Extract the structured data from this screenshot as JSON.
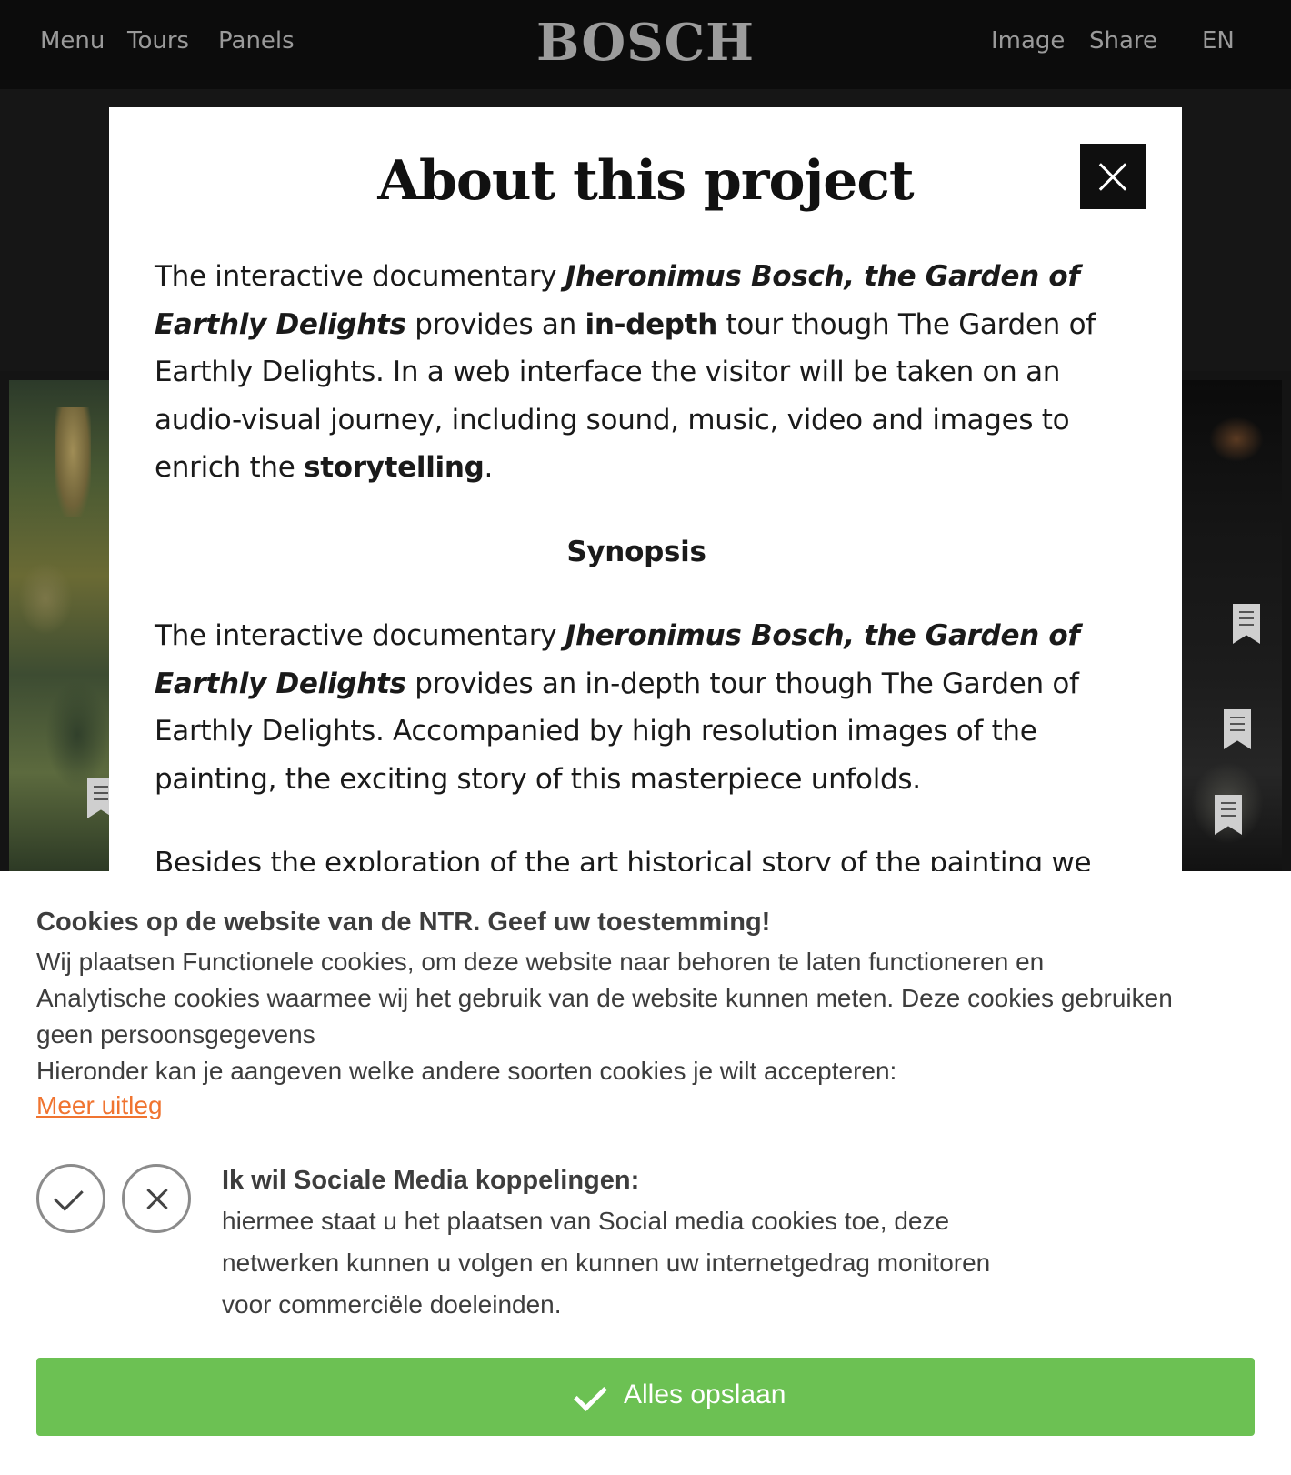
{
  "nav": {
    "left": [
      "Menu",
      "Tours",
      "Panels"
    ],
    "logo": "BOSCH",
    "right": [
      "Image",
      "Share"
    ],
    "lang": "EN"
  },
  "modal": {
    "title": "About this project",
    "p1": {
      "t1": "The interactive documentary ",
      "e1": "Jheronimus Bosch, the Garden of Earthly Delights",
      "t2": " provides an ",
      "b1": "in-depth",
      "t3": " tour though The Garden of Earthly Delights. In a web interface the visitor will be taken on an audio-visual journey, including sound, music, video and images to enrich the ",
      "b2": "storytelling",
      "t4": "."
    },
    "synopsis_heading": "Synopsis",
    "p2": {
      "t1": "The interactive documentary ",
      "e1": "Jheronimus Bosch, the Garden of Earthly Delights",
      "t2": " provides an in-depth tour though The Garden of Earthly Delights. Accompanied by high resolution images of the painting, the exciting story of this masterpiece unfolds."
    },
    "p3": "Besides the exploration of the art historical story of the painting we will"
  },
  "cookie": {
    "title": "Cookies op de website van de NTR. Geef uw toestemming!",
    "desc_lines": [
      "Wij plaatsen Functionele cookies, om deze website naar behoren te laten functioneren en",
      "Analytische cookies waarmee wij het gebruik van de website kunnen meten. Deze cookies gebruiken",
      "geen persoonsgegevens",
      "Hieronder kan je aangeven welke andere soorten cookies je wilt accepteren:"
    ],
    "link": "Meer uitleg",
    "social_title": "Ik wil Sociale Media koppelingen:",
    "social_desc": "hiermee staat u het plaatsen van Social media cookies toe, deze netwerken kunnen u volgen en kunnen uw internetgedrag monitoren voor commerciële doeleinden.",
    "save_label": "Alles opslaan"
  },
  "colors": {
    "save_button": "#6cc153",
    "link": "#f07430",
    "topbar": "#0c0c0c"
  },
  "icons": [
    "close-icon",
    "check-icon",
    "cross-icon",
    "bookmark-icon"
  ]
}
